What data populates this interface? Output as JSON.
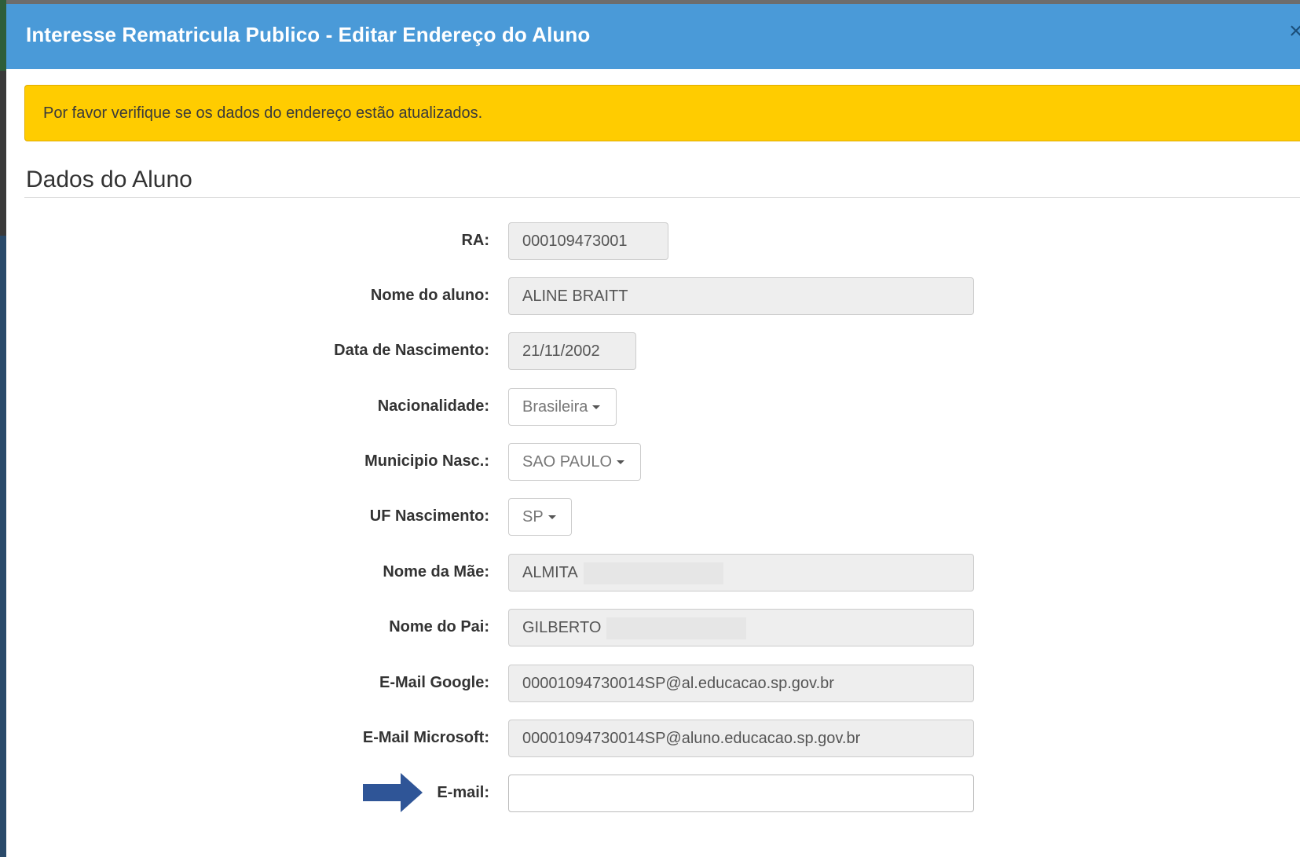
{
  "modal": {
    "title": "Interesse Rematricula Publico - Editar Endereço do Aluno",
    "close_glyph": "×"
  },
  "alert": {
    "text": "Por favor verifique se os dados do endereço estão atualizados."
  },
  "section": {
    "title": "Dados do Aluno"
  },
  "fields": {
    "ra": {
      "label": "RA:",
      "value": "000109473001"
    },
    "nome_aluno": {
      "label": "Nome do aluno:",
      "value": "ALINE BRAITT"
    },
    "data_nascimento": {
      "label": "Data de Nascimento:",
      "value": "21/11/2002"
    },
    "nacionalidade": {
      "label": "Nacionalidade:",
      "value": "Brasileira"
    },
    "municipio_nasc": {
      "label": "Municipio Nasc.:",
      "value": "SAO PAULO"
    },
    "uf_nascimento": {
      "label": "UF Nascimento:",
      "value": "SP"
    },
    "nome_mae": {
      "label": "Nome da Mãe:",
      "value": "ALMITA"
    },
    "nome_pai": {
      "label": "Nome do Pai:",
      "value": "GILBERTO"
    },
    "email_google": {
      "label": "E-Mail Google:",
      "value": "00001094730014SP@al.educacao.sp.gov.br"
    },
    "email_microsoft": {
      "label": "E-Mail Microsoft:",
      "value": "00001094730014SP@aluno.educacao.sp.gov.br"
    },
    "email": {
      "label": "E-mail:",
      "value": ""
    }
  },
  "colors": {
    "header": "#4a9ad8",
    "alert": "#ffcc00",
    "arrow": "#2f5597"
  },
  "icons": {
    "arrow": "right-arrow-icon",
    "caret": "caret-down-icon",
    "close": "close-icon"
  }
}
